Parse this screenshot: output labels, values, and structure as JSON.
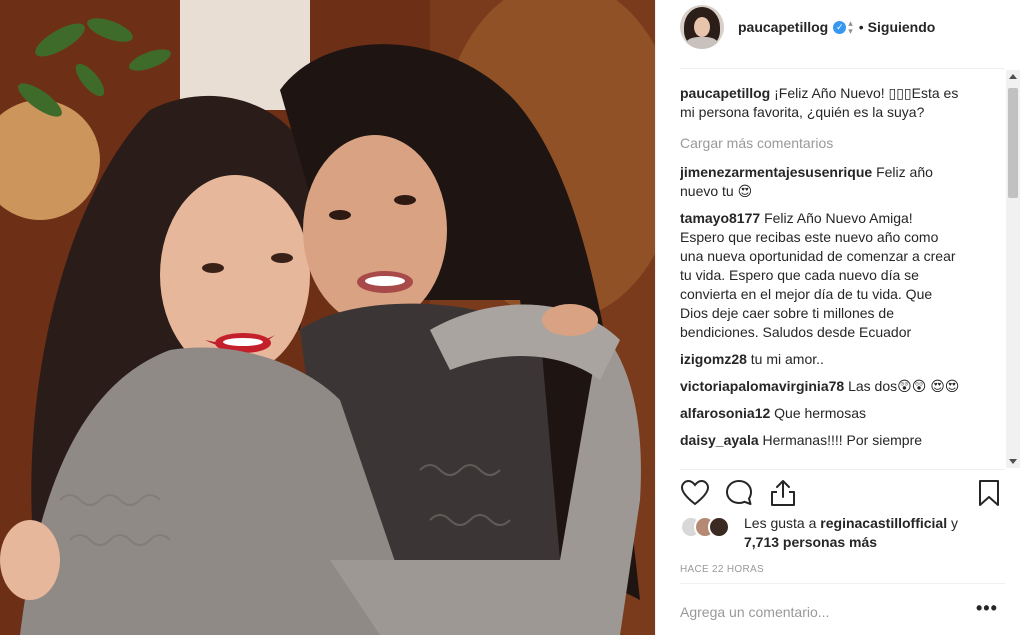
{
  "post": {
    "author": "paucapetillog",
    "follow_separator": "•",
    "follow_status": "Siguiendo",
    "caption": "¡Feliz Año Nuevo! ▯▯▯Esta es mi persona favorita, ¿quién es la suya?",
    "load_more": "Cargar más comentarios",
    "comments": [
      {
        "user": "jimenezarmentajesusenrique",
        "text": "Feliz año nuevo tu 😍"
      },
      {
        "user": "tamayo8177",
        "text": "Feliz Año Nuevo Amiga! Espero que recibas este nuevo año como una nueva oportunidad de comenzar a crear tu vida. Espero que cada nuevo día se convierta en el mejor día de tu vida. Que Dios deje caer sobre ti millones de bendiciones. Saludos desde Ecuador"
      },
      {
        "user": "izigomz28",
        "text": "tu mi amor.."
      },
      {
        "user": "victoriapalomavirginia78",
        "text": "Las dos😲😲 😍😍"
      },
      {
        "user": "alfarosonia12",
        "text": "Que hermosas"
      },
      {
        "user": "daisy_ayala",
        "text": "Hermanas!!!! Por siempre"
      }
    ],
    "likes_prefix": "Les gusta a",
    "likes_user": "reginacastillofficial",
    "likes_and": "y",
    "likes_count": "7,713 personas más",
    "timestamp": "HACE 22 HORAS",
    "add_comment_placeholder": "Agrega un comentario...",
    "more_options": "•••"
  },
  "colors": {
    "verified": "#3897f0",
    "secondary_text": "#999999",
    "primary_text": "#262626"
  },
  "icons": [
    "heart-icon",
    "comment-icon",
    "share-icon",
    "bookmark-icon",
    "verified-icon",
    "more-options-icon"
  ]
}
